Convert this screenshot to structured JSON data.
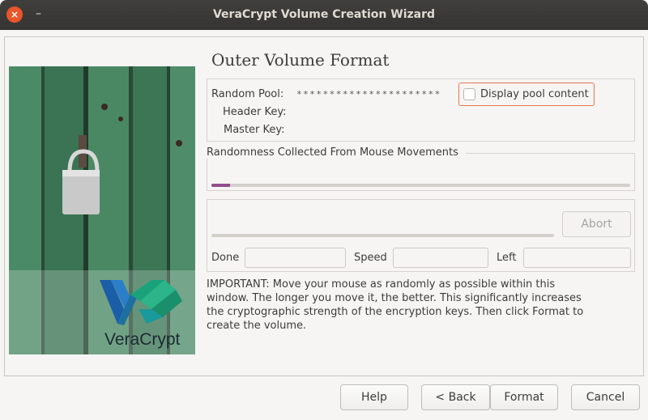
{
  "window": {
    "title": "VeraCrypt Volume Creation Wizard",
    "close_glyph": "×",
    "minimize_glyph": "–"
  },
  "sidebar": {
    "logo_text": "VeraCrypt"
  },
  "page": {
    "heading": "Outer Volume Format"
  },
  "keys": {
    "random_pool_label": "Random Pool:",
    "random_pool_value": "**********************",
    "header_key_label": "Header Key:",
    "master_key_label": "Master Key:",
    "display_pool_label": "Display pool content",
    "display_pool_checked": false
  },
  "randomness": {
    "title": "Randomness Collected From Mouse Movements",
    "progress_fraction": 0.045,
    "bar_color": "#924d8b"
  },
  "progress": {
    "progress_fraction": 0,
    "abort_label": "Abort",
    "done_label": "Done",
    "done_value": "",
    "speed_label": "Speed",
    "speed_value": "",
    "left_label": "Left",
    "left_value": ""
  },
  "important_text": "IMPORTANT: Move your mouse as randomly as possible within this window. The longer you move it, the better. This significantly increases the cryptographic strength of the encryption keys. Then click Format to create the volume.",
  "buttons": {
    "help": "Help",
    "back": "< Back",
    "format": "Format",
    "cancel": "Cancel"
  },
  "colors": {
    "titlebar": "#3c3b37",
    "close_button": "#e9552a",
    "focus_outline": "#e9754f",
    "door_green": "#3f7a58",
    "logo_blue": "#1a5ea8",
    "logo_teal": "#1aa37a"
  }
}
